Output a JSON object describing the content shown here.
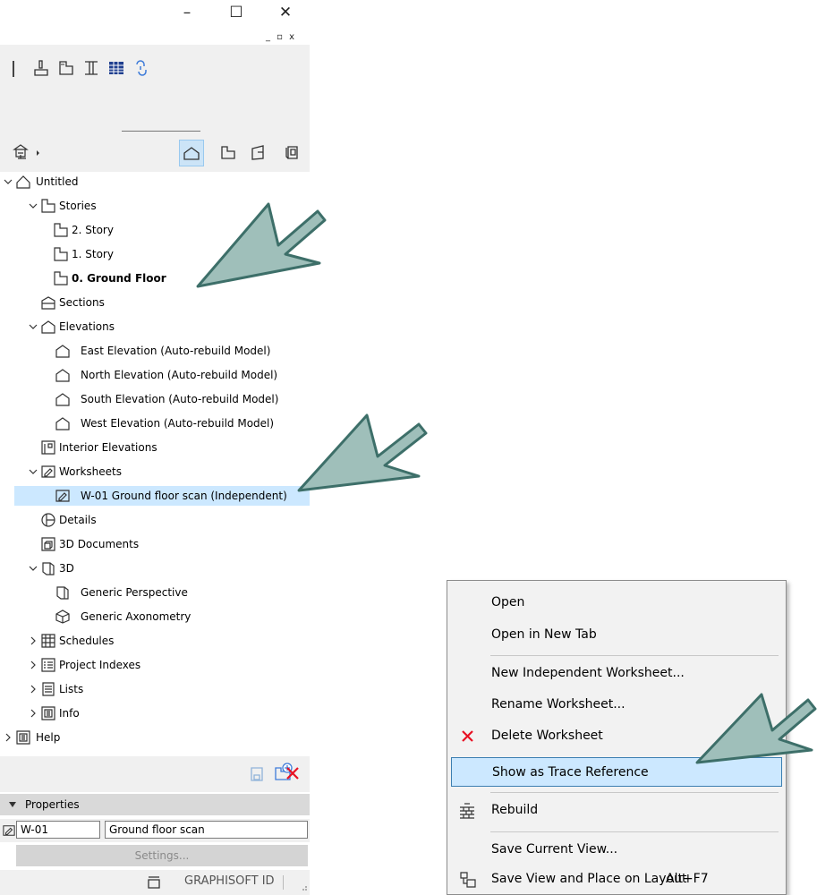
{
  "window": {
    "minimize": "–",
    "maximize": "☐",
    "close": "✕",
    "doc_controls": "_ ▫ x"
  },
  "toolbar": {
    "icons": [
      "brush-icon",
      "story-settings-icon",
      "beam-icon",
      "grid-icon",
      "link-icon"
    ]
  },
  "navigator": {
    "view_buttons": [
      "project-map-icon",
      "view-map-icon",
      "layout-book-icon",
      "publisher-sets-icon"
    ]
  },
  "tree": {
    "untitled": "Untitled",
    "stories": "Stories",
    "story2": "2. Story",
    "story1": "1. Story",
    "story0": "0. Ground Floor",
    "sections": "Sections",
    "elevations": "Elevations",
    "east": "East Elevation (Auto-rebuild Model)",
    "north": "North Elevation (Auto-rebuild Model)",
    "south": "South Elevation (Auto-rebuild Model)",
    "west": "West Elevation (Auto-rebuild Model)",
    "interior": "Interior Elevations",
    "worksheets": "Worksheets",
    "w01": "W-01 Ground floor scan (Independent)",
    "details": "Details",
    "docs3d": "3D Documents",
    "threed": "3D",
    "perspective": "Generic Perspective",
    "axonometry": "Generic Axonometry",
    "schedules": "Schedules",
    "indexes": "Project Indexes",
    "lists": "Lists",
    "info": "Info",
    "help": "Help"
  },
  "properties": {
    "header": "Properties",
    "id_value": "W-01",
    "name_value": "Ground floor scan",
    "settings_label": "Settings..."
  },
  "status": {
    "graphisoft_id": "GRAPHISOFT ID"
  },
  "context_menu": {
    "open": "Open",
    "open_new_tab": "Open in New Tab",
    "new_independent": "New Independent Worksheet...",
    "rename": "Rename Worksheet...",
    "delete": "Delete Worksheet",
    "show_trace": "Show as Trace Reference",
    "rebuild": "Rebuild",
    "save_view": "Save Current View...",
    "save_place": "Save View and Place on Layout",
    "save_place_shortcut": "Alt+F7"
  },
  "colors": {
    "selection": "#cce8ff",
    "arrow_fill": "#9fbfba",
    "arrow_stroke": "#3d6f69",
    "delete_red": "#e81123"
  }
}
